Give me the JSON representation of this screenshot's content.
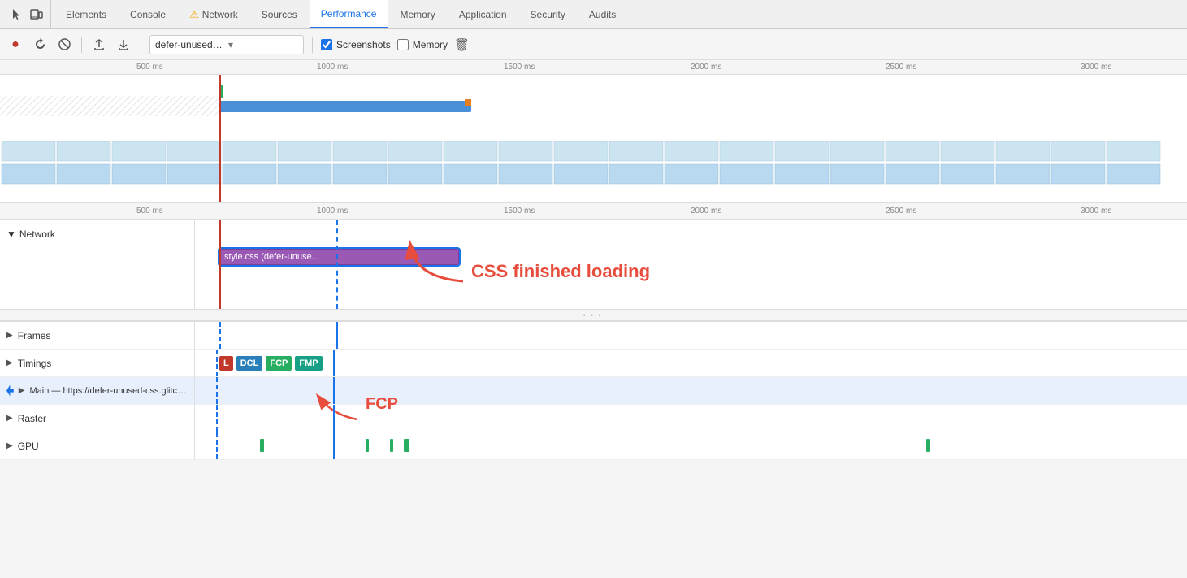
{
  "tabs": [
    {
      "id": "elements",
      "label": "Elements",
      "active": false,
      "warning": false
    },
    {
      "id": "console",
      "label": "Console",
      "active": false,
      "warning": false
    },
    {
      "id": "network",
      "label": "Network",
      "active": false,
      "warning": true
    },
    {
      "id": "sources",
      "label": "Sources",
      "active": false,
      "warning": false
    },
    {
      "id": "performance",
      "label": "Performance",
      "active": true,
      "warning": false
    },
    {
      "id": "memory",
      "label": "Memory",
      "active": false,
      "warning": false
    },
    {
      "id": "application",
      "label": "Application",
      "active": false,
      "warning": false
    },
    {
      "id": "security",
      "label": "Security",
      "active": false,
      "warning": false
    },
    {
      "id": "audits",
      "label": "Audits",
      "active": false,
      "warning": false
    }
  ],
  "toolbar": {
    "record_label": "●",
    "reload_label": "↺",
    "clear_label": "🚫",
    "upload_label": "↑",
    "download_label": "↓",
    "url_value": "defer-unused-css.glitch....",
    "screenshots_label": "Screenshots",
    "memory_label": "Memory",
    "trash_label": "🗑"
  },
  "ruler": {
    "marks": [
      "500 ms",
      "1000 ms",
      "1500 ms",
      "2000 ms",
      "2500 ms",
      "3000 ms"
    ]
  },
  "lower_ruler": {
    "marks": [
      "500 ms",
      "1000 ms",
      "1500 ms",
      "2000 ms",
      "2500 ms",
      "3000 ms"
    ]
  },
  "network_section": {
    "label": "Network",
    "bar_label": "style.css (defer-unuse..."
  },
  "annotation": {
    "css_label": "CSS finished loading",
    "fcp_label": "FCP"
  },
  "bottom_rows": [
    {
      "id": "frames",
      "label": "Frames",
      "has_triangle": true
    },
    {
      "id": "timings",
      "label": "Timings",
      "has_triangle": true
    },
    {
      "id": "main",
      "label": "Main — https://defer-unused-css.glitch.me/index-optimized.html",
      "has_triangle": true,
      "has_icon": true
    },
    {
      "id": "raster",
      "label": "Raster",
      "has_triangle": true
    },
    {
      "id": "gpu",
      "label": "GPU",
      "has_triangle": true
    }
  ],
  "timing_badges": [
    {
      "label": "L",
      "class": "badge-l"
    },
    {
      "label": "DCL",
      "class": "badge-dcl"
    },
    {
      "label": "FCP",
      "class": "badge-fcp"
    },
    {
      "label": "FMP",
      "class": "badge-fmp"
    }
  ],
  "colors": {
    "accent_blue": "#1a73e8",
    "red_line": "#c0392b",
    "network_bar": "#9b59b6",
    "annotation_red": "#e74c3c"
  }
}
